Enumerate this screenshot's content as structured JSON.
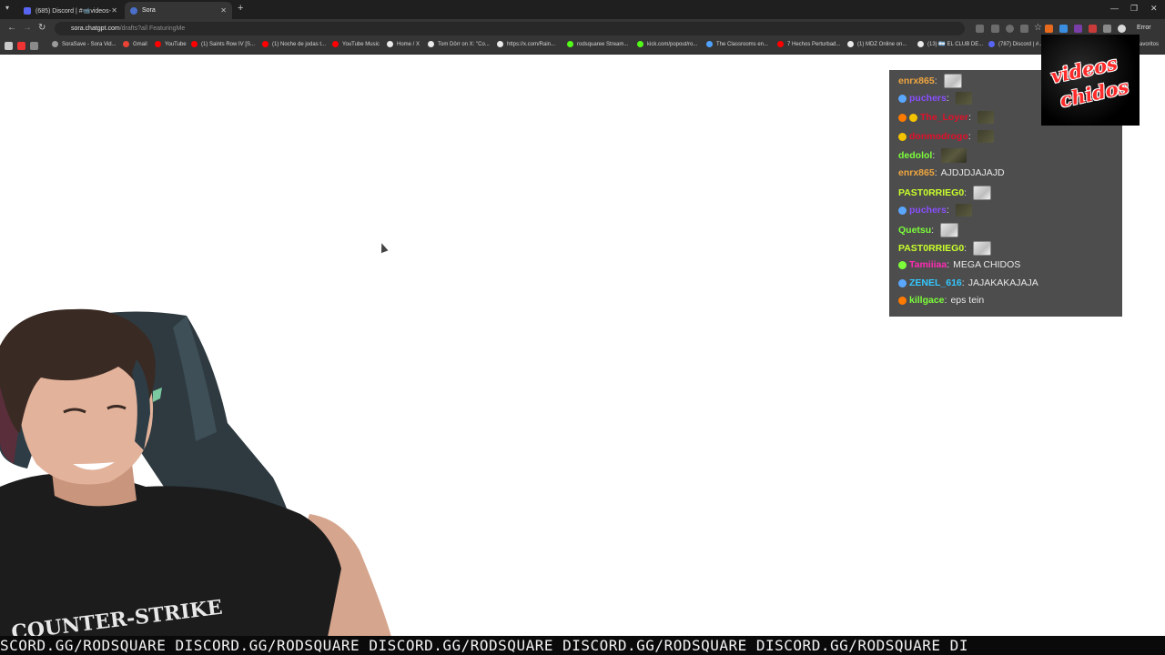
{
  "browser": {
    "tabs": [
      {
        "title": "(685) Discord | #📹videos-ca...",
        "favicon_color": "#5865f2"
      },
      {
        "title": "Sora",
        "favicon_color": "#cfcfcf"
      }
    ],
    "url_host": "sora.chatgpt.com",
    "url_path": "/drafts?all FeaturingMe",
    "error_label": "Error",
    "bookmarks": [
      {
        "label": "SoraSave - Sora Vid...",
        "color": "#9a9a9a"
      },
      {
        "label": "Gmail",
        "color": "#ea4335"
      },
      {
        "label": "YouTube",
        "color": "#ff0000"
      },
      {
        "label": "(1) Saints Row IV [S...",
        "color": "#ff0000"
      },
      {
        "label": "(1) Noche de jodas t...",
        "color": "#ff0000"
      },
      {
        "label": "YouTube Music",
        "color": "#ff0000"
      },
      {
        "label": "Home / X",
        "color": "#eaeaea"
      },
      {
        "label": "Tom Dörr on X: \"Co...",
        "color": "#eaeaea"
      },
      {
        "label": "https://x.com/Rain...",
        "color": "#eaeaea"
      },
      {
        "label": "rodsquaree Stream...",
        "color": "#53fc18"
      },
      {
        "label": "kick.com/popout/ro...",
        "color": "#53fc18"
      },
      {
        "label": "The Classrooms en...",
        "color": "#4fa3ff"
      },
      {
        "label": "7 Hechos Perturbad...",
        "color": "#ff0000"
      },
      {
        "label": "(1) MDZ Online on...",
        "color": "#eaeaea"
      },
      {
        "label": "(13) 🇦🇷 EL CLUB DE...",
        "color": "#eaeaea"
      },
      {
        "label": "(787) Discord | #...",
        "color": "#5865f2"
      }
    ],
    "favorites_label": "avoritos"
  },
  "chat": {
    "messages": [
      {
        "user": "enrx865",
        "color": "#f0a640",
        "text": "",
        "emote": "light",
        "badges": []
      },
      {
        "user": "puchers",
        "color": "#8a4fff",
        "text": "",
        "emote": "small",
        "badges": [
          "#5aa7ff"
        ]
      },
      {
        "user": "The_Loyer",
        "color": "#e0102a",
        "text": "",
        "emote": "small",
        "badges": [
          "#ff7a00",
          "#f5c400"
        ]
      },
      {
        "user": "donmodrogo",
        "color": "#e0102a",
        "text": "",
        "emote": "small",
        "badges": [
          "#f5c400"
        ]
      },
      {
        "user": "dedolol",
        "color": "#7cff3a",
        "text": "",
        "emote": "dark",
        "badges": []
      },
      {
        "user": "enrx865",
        "color": "#f0a640",
        "text": "AJDJDJAJAJD",
        "emote": "",
        "badges": []
      },
      {
        "user": "PAST0RRIEG0",
        "color": "#c8ff2a",
        "text": "",
        "emote": "light",
        "badges": []
      },
      {
        "user": "puchers",
        "color": "#8a4fff",
        "text": "",
        "emote": "small",
        "badges": [
          "#5aa7ff"
        ]
      },
      {
        "user": "Quetsu",
        "color": "#7cff3a",
        "text": "",
        "emote": "light",
        "badges": []
      },
      {
        "user": "PAST0RRIEG0",
        "color": "#c8ff2a",
        "text": "",
        "emote": "light",
        "badges": []
      },
      {
        "user": "Tamiiiaa",
        "color": "#ff2bb3",
        "text": "MEGA CHIDOS",
        "emote": "",
        "badges": [
          "#7cff3a"
        ]
      },
      {
        "user": "ZENEL_616",
        "color": "#33c8ff",
        "text": "JAJAKAKAJAJA",
        "emote": "",
        "badges": [
          "#5aa7ff"
        ]
      },
      {
        "user": "killgace",
        "color": "#7cff3a",
        "text": "eps tein",
        "emote": "",
        "badges": [
          "#ff7a00"
        ]
      }
    ]
  },
  "logo": {
    "line1": "videos",
    "line2": "chidos"
  },
  "shirt_text": "COUNTER-STRIKE",
  "ticker_text": "SCORD.GG/RODSQUARE DISCORD.GG/RODSQUARE DISCORD.GG/RODSQUARE DISCORD.GG/RODSQUARE DISCORD.GG/RODSQUARE DI"
}
